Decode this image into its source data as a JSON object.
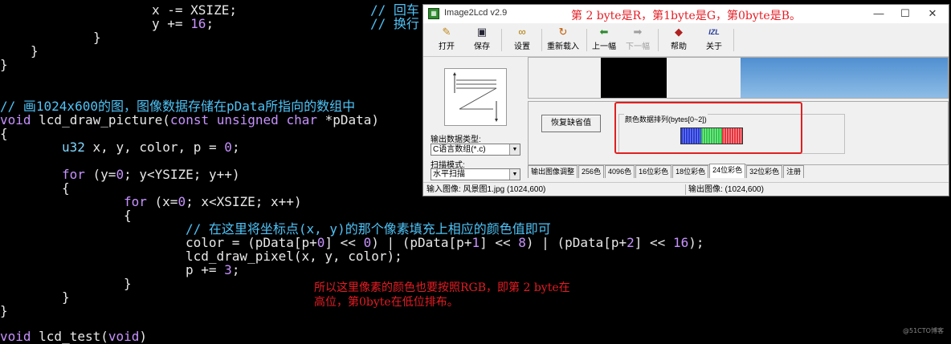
{
  "code": {
    "line1_indent": "                   ",
    "line1_a": "x -= XSIZE;",
    "line1_c": "// 回车",
    "line2_a": "y += ",
    "line2_num": "16",
    "line2_b": ";",
    "line2_c": "// 换行",
    "brace_close_inner": "}",
    "brace_close_mid": "}",
    "brace_close_fn": "}",
    "comment_draw": "// 画1024x600的图，图像数据存储在pData所指向的数组中",
    "sig_void": "void",
    "sig_name": " lcd_draw_picture(",
    "sig_const": "const",
    "sig_unsigned": "unsigned",
    "sig_char": "char",
    "sig_rest": " *pData)",
    "open_brace": "{",
    "decl_type": "u32",
    "decl_rest": " x, y, color, p = ",
    "decl_num": "0",
    "decl_end": ";",
    "for1_kw": "for",
    "for1_a": " (y=",
    "for1_num": "0",
    "for1_b": "; y<YSIZE; y++)",
    "brace1": "{",
    "for2_kw": "for",
    "for2_a": " (x=",
    "for2_num": "0",
    "for2_b": "; x<XSIZE; x++)",
    "brace2": "{",
    "comment_pixel": "// 在这里将坐标点(x, y)的那个像素填充上相应的颜色值即可",
    "color_a": "color = (pData[p+",
    "color_n0": "0",
    "color_b": "] << ",
    "color_n0b": "0",
    "color_c": ") | (pData[p+",
    "color_n1": "1",
    "color_d": "] << ",
    "color_n8": "8",
    "color_e": ") | (pData[p+",
    "color_n2": "2",
    "color_f": "] << ",
    "color_n16": "16",
    "color_g": ");",
    "draw_pixel": "lcd_draw_pixel(x, y, color);",
    "p_inc_a": "p += ",
    "p_inc_num": "3",
    "p_inc_b": ";",
    "close2": "}",
    "close1": "}",
    "close_fn": "}",
    "next_void": "void",
    "next_name": " lcd_test(",
    "next_arg": "void",
    "next_end": ")"
  },
  "notes": {
    "rgb_note_line1": "所以这里像素的颜色也要按照RGB，即第 2 byte在",
    "rgb_note_line2": "高位，第0byte在低位排布。",
    "byte_note": "第 2 byte是R，第1byte是G，第0byte是B。"
  },
  "window": {
    "title": "Image2Lcd v2.9",
    "minimize": "—",
    "maximize": "☐",
    "close": "✕",
    "toolbar": {
      "open": "打开",
      "save": "保存",
      "settings": "设置",
      "reload": "重新载入",
      "prev": "上一幅",
      "next": "下一幅",
      "help": "帮助",
      "about": "关于",
      "about_icon_text": "IZL"
    },
    "output_type_label": "输出数据类型:",
    "output_type_value": "C语言数组(*.c)",
    "scan_mode_label": "扫描模式:",
    "scan_mode_value": "水平扫描",
    "restore_button": "恢复缺省值",
    "color_order_title": "颜色数据排列(bytes[0~2])",
    "tabs": [
      "输出图像调整",
      "256色",
      "4096色",
      "16位彩色",
      "18位彩色",
      "24位彩色",
      "32位彩色",
      "注册"
    ],
    "status_input": "输入图像: 风景图1.jpg (1024,600)",
    "status_output": "输出图像: (1024,600)"
  },
  "watermark": "@51CTO博客",
  "colors": {
    "keyword": "#c792ff",
    "type": "#7fd7ff",
    "comment": "#4fc3f7",
    "annotation": "#e51c23",
    "blue_bar": "#2a3bd6",
    "green_bar": "#2ec84a",
    "red_bar": "#e8323c"
  }
}
